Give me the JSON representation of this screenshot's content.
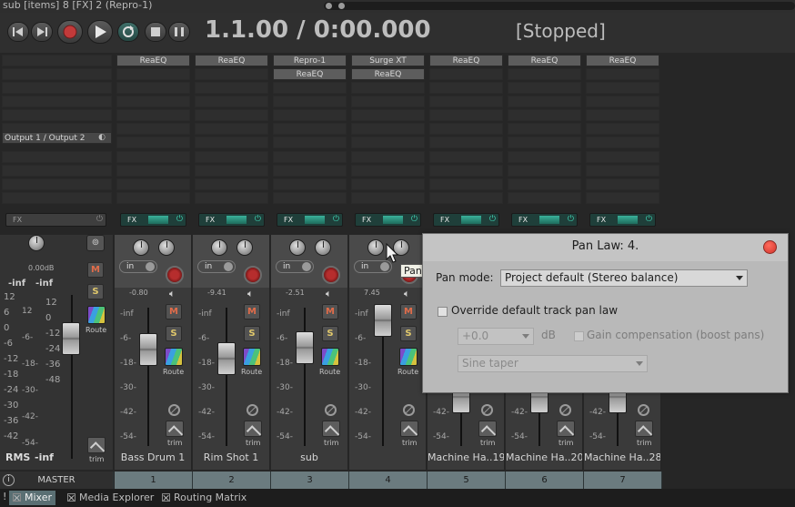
{
  "window": {
    "title": "sub [items] 8 [FX] 2 (Repro-1)"
  },
  "transport": {
    "time": "1.1.00 / 0:00.000",
    "status": "[Stopped]",
    "buttons": [
      "skip-back",
      "skip-forward",
      "record",
      "play",
      "repeat",
      "stop",
      "pause"
    ]
  },
  "master": {
    "output_routing": "Output 1 / Output 2",
    "fx_label": "FX",
    "volume": "0.00dB",
    "meter_left": "-inf",
    "meter_right": "-inf",
    "scale": [
      "12",
      "6",
      "0",
      "-6",
      "-12",
      "-18",
      "-24",
      "-30",
      "-36",
      "-42"
    ],
    "scale_inner": [
      "12",
      "-6-",
      "-18-",
      "-30-",
      "-42-",
      "-54-"
    ],
    "rms_label": "RMS",
    "rms_value": "-inf",
    "mute": "M",
    "solo": "S",
    "route": "Route",
    "trim": "trim",
    "label": "MASTER"
  },
  "tracks": [
    {
      "number": "1",
      "name": "Bass Drum 1",
      "fx": [
        "ReaEQ"
      ],
      "volume": "-0.80",
      "input": "in"
    },
    {
      "number": "2",
      "name": "Rim Shot 1",
      "fx": [
        "ReaEQ"
      ],
      "volume": "-9.41",
      "input": "in"
    },
    {
      "number": "3",
      "name": "sub",
      "fx": [
        "Repro-1",
        "ReaEQ"
      ],
      "volume": "-2.51",
      "input": "in"
    },
    {
      "number": "4",
      "name": "",
      "fx": [
        "Surge XT",
        "ReaEQ"
      ],
      "volume": "7.45",
      "input": "in"
    },
    {
      "number": "5",
      "name": "Machine Ha..19",
      "fx": [
        "ReaEQ"
      ],
      "volume": "",
      "input": "in"
    },
    {
      "number": "6",
      "name": "Machine Ha..20",
      "fx": [
        "ReaEQ"
      ],
      "volume": "",
      "input": "in"
    },
    {
      "number": "7",
      "name": "Machine Ha..28",
      "fx": [
        "ReaEQ"
      ],
      "volume": "",
      "input": "in"
    }
  ],
  "strip_labels": {
    "fx": "FX",
    "mute": "M",
    "solo": "S",
    "route": "Route",
    "trim": "trim",
    "scale": [
      "-inf",
      "-6-",
      "-18-",
      "-30-",
      "-42-",
      "-54-"
    ]
  },
  "tooltip": {
    "text": "Pan: center"
  },
  "dialog": {
    "title": "Pan Law: 4.",
    "pan_mode_label": "Pan mode:",
    "pan_mode_value": "Project default (Stereo balance)",
    "override_label": "Override default track pan law",
    "override_checked": false,
    "db_value": "+0.0",
    "db_unit": "dB",
    "gain_comp_label": "Gain compensation (boost pans)",
    "gain_comp_checked": false,
    "taper_value": "Sine taper"
  },
  "tabs": [
    {
      "label": "Mixer",
      "active": true
    },
    {
      "label": "Media Explorer",
      "active": false
    },
    {
      "label": "Routing Matrix",
      "active": false
    }
  ],
  "colors": {
    "accent_fx": "#1f3f3a",
    "record": "#b62d2d",
    "tab_active": "#5a6f73",
    "dialog_bg": "#b9b9b9"
  }
}
